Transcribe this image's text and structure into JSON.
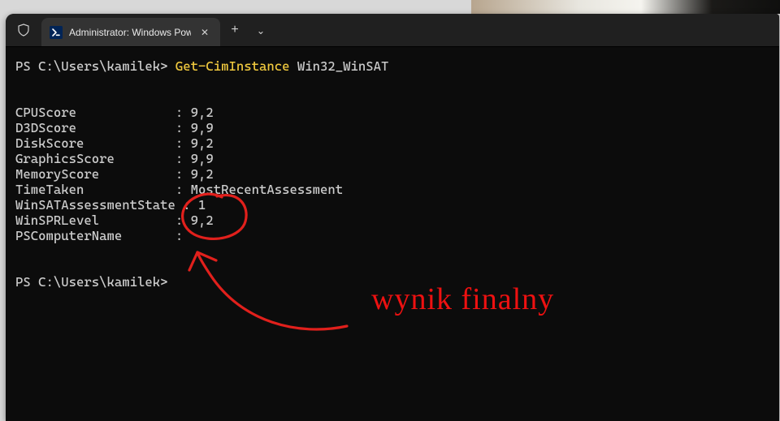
{
  "titlebar": {
    "tab_title": "Administrator: Windows Powe",
    "close_glyph": "✕",
    "new_tab_glyph": "+",
    "dropdown_glyph": "⌄"
  },
  "prompt1": {
    "ps": "PS ",
    "path": "C:\\Users\\kamilek> ",
    "cmdlet": "Get-CimInstance",
    "arg": " Win32_WinSAT"
  },
  "results": [
    {
      "name": "CPUScore",
      "value": "9,2"
    },
    {
      "name": "D3DScore",
      "value": "9,9"
    },
    {
      "name": "DiskScore",
      "value": "9,2"
    },
    {
      "name": "GraphicsScore",
      "value": "9,9"
    },
    {
      "name": "MemoryScore",
      "value": "9,2"
    },
    {
      "name": "TimeTaken",
      "value": "MostRecentAssessment"
    },
    {
      "name": "WinSATAssessmentState",
      "value": "1"
    },
    {
      "name": "WinSPRLevel",
      "value": "9,2"
    },
    {
      "name": "PSComputerName",
      "value": ""
    }
  ],
  "name_col_width": 21,
  "prompt2": {
    "ps": "PS ",
    "path": "C:\\Users\\kamilek>"
  },
  "annotation": {
    "text": "wynik finalny"
  },
  "colors": {
    "cmdlet": "#f0c93e",
    "annotation": "#e1201c"
  }
}
